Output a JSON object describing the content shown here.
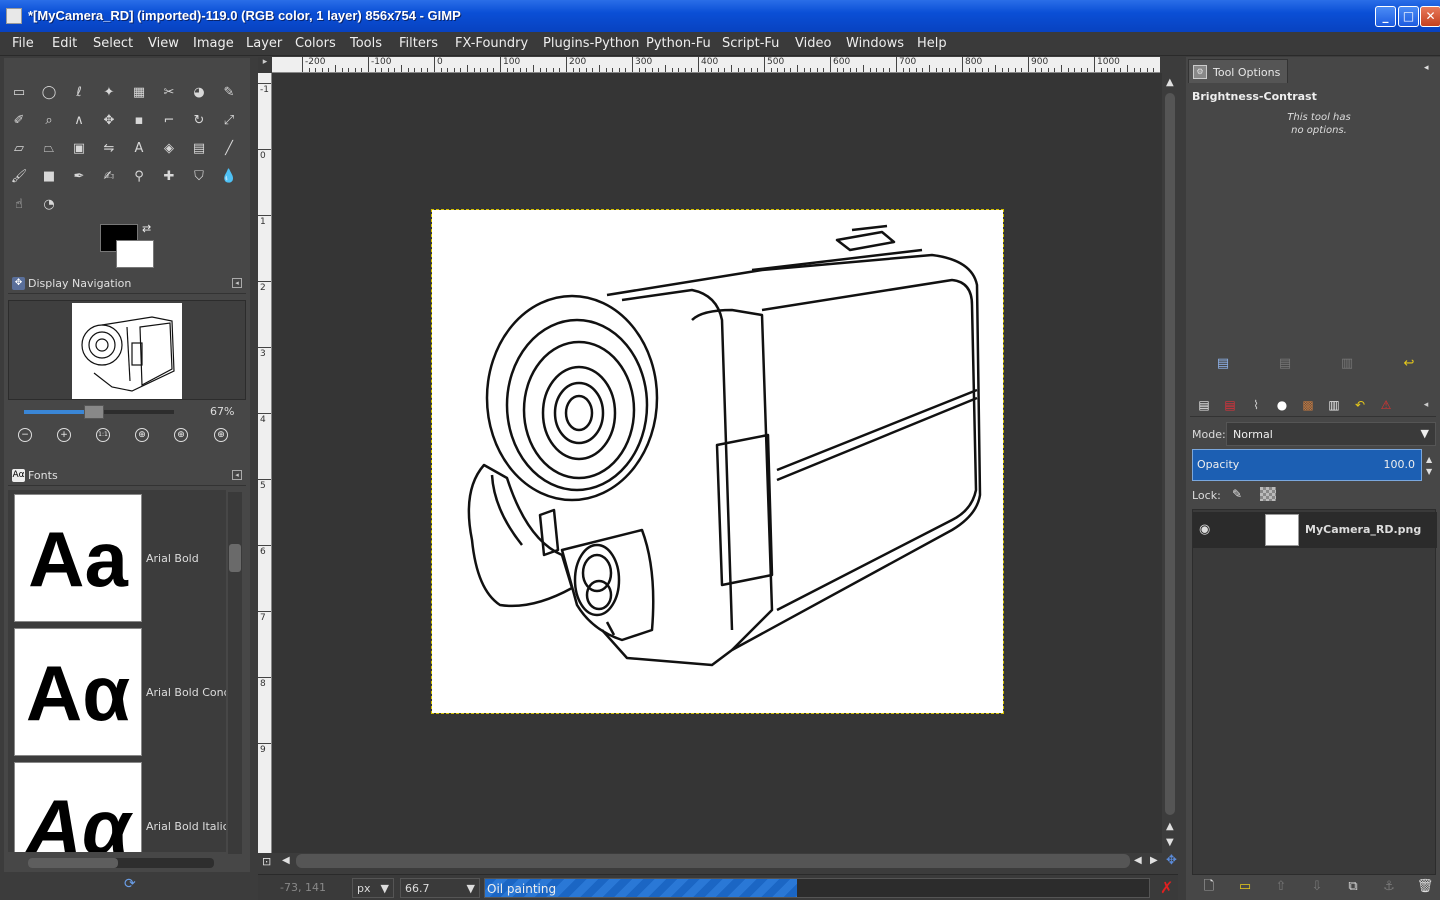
{
  "window": {
    "title": "*[MyCamera_RD] (imported)-119.0 (RGB color, 1 layer) 856x754 - GIMP",
    "buttons": {
      "minimize": "_",
      "maximize": "□",
      "close": "✕"
    }
  },
  "menu": [
    "File",
    "Edit",
    "Select",
    "View",
    "Image",
    "Layer",
    "Colors",
    "Tools",
    "Filters",
    "FX-Foundry",
    "Plugins-Python",
    "Python-Fu",
    "Script-Fu",
    "Video",
    "Windows",
    "Help"
  ],
  "toolbox": {
    "tools": [
      {
        "name": "rect-select-icon",
        "glyph": "▭"
      },
      {
        "name": "ellipse-select-icon",
        "glyph": "◯"
      },
      {
        "name": "free-select-icon",
        "glyph": "ℓ"
      },
      {
        "name": "fuzzy-select-icon",
        "glyph": "✦"
      },
      {
        "name": "color-select-icon",
        "glyph": "▦"
      },
      {
        "name": "scissors-select-icon",
        "glyph": "✂"
      },
      {
        "name": "foreground-select-icon",
        "glyph": "◕"
      },
      {
        "name": "paths-icon",
        "glyph": "✎"
      },
      {
        "name": "color-picker-icon",
        "glyph": "✐"
      },
      {
        "name": "zoom-icon",
        "glyph": "⌕"
      },
      {
        "name": "measure-icon",
        "glyph": "∧"
      },
      {
        "name": "move-icon",
        "glyph": "✥"
      },
      {
        "name": "align-icon",
        "glyph": "▪"
      },
      {
        "name": "crop-icon",
        "glyph": "⌐"
      },
      {
        "name": "rotate-icon",
        "glyph": "↻"
      },
      {
        "name": "scale-icon",
        "glyph": "⤢"
      },
      {
        "name": "shear-icon",
        "glyph": "▱"
      },
      {
        "name": "perspective-icon",
        "glyph": "⏢"
      },
      {
        "name": "cage-transform-icon",
        "glyph": "▣"
      },
      {
        "name": "flip-icon",
        "glyph": "⇋"
      },
      {
        "name": "text-icon",
        "glyph": "A"
      },
      {
        "name": "bucket-fill-icon",
        "glyph": "◈"
      },
      {
        "name": "blend-icon",
        "glyph": "▤"
      },
      {
        "name": "pencil-icon",
        "glyph": "╱"
      },
      {
        "name": "paintbrush-icon",
        "glyph": "🖌"
      },
      {
        "name": "eraser-icon",
        "glyph": "■"
      },
      {
        "name": "airbrush-icon",
        "glyph": "✒"
      },
      {
        "name": "ink-icon",
        "glyph": "✍"
      },
      {
        "name": "clone-icon",
        "glyph": "⚲"
      },
      {
        "name": "heal-icon",
        "glyph": "✚"
      },
      {
        "name": "perspective-clone-icon",
        "glyph": "⛉"
      },
      {
        "name": "blur-sharpen-icon",
        "glyph": "💧"
      },
      {
        "name": "smudge-icon",
        "glyph": "☝"
      },
      {
        "name": "dodge-burn-icon",
        "glyph": "◔"
      }
    ],
    "fg_color": "#000000",
    "bg_color": "#ffffff"
  },
  "navigation": {
    "title": "Display Navigation",
    "zoom_percent": "67%",
    "zoom_fraction": 0.45,
    "buttons": [
      "−",
      "+",
      "1:1",
      "⊕",
      "⊕",
      "⊕"
    ]
  },
  "fonts": {
    "title": "Fonts",
    "items": [
      {
        "sample": "Aa",
        "name": "Arial Bold"
      },
      {
        "sample": "Aα",
        "name": "Arial Bold Conde"
      },
      {
        "sample": "Aα",
        "name": "Arial Bold Italic"
      }
    ]
  },
  "rulers": {
    "top": [
      "-200",
      "-100",
      "0",
      "100",
      "200",
      "300",
      "400",
      "500",
      "600",
      "700",
      "800",
      "900",
      "1000"
    ],
    "left": [
      "-1",
      "0",
      "1",
      "2",
      "3",
      "4",
      "5",
      "6",
      "7",
      "8",
      "9"
    ]
  },
  "status": {
    "coords": "-73, 141",
    "unit": "px",
    "zoom": "66.7",
    "progress_label": "Oil painting",
    "progress_fraction": 0.47
  },
  "tool_options": {
    "tab": "Tool Options",
    "tool_name": "Brightness-Contrast",
    "note": "This tool has no options."
  },
  "layers": {
    "mode_label": "Mode:",
    "mode_value": "Normal",
    "opacity_label": "Opacity",
    "opacity_value": "100.0",
    "lock_label": "Lock:",
    "layer_name": "MyCamera_RD.png"
  },
  "colors": {
    "titlebar": "#0a4fd6",
    "accent": "#1c5fb3",
    "canvas_bg": "#353535",
    "panel_bg": "#474747"
  }
}
